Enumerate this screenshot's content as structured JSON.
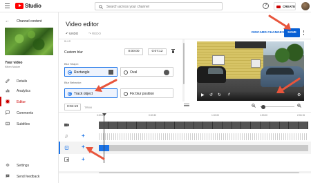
{
  "header": {
    "logo_text": "Studio",
    "search_placeholder": "Search across your channel",
    "help_symbol": "?",
    "create_label": "CREATE"
  },
  "sidebar": {
    "back_label": "Channel content",
    "video_title": "Your video",
    "video_subtitle": "Kitten Nature",
    "items": [
      {
        "label": "Details",
        "icon": "pencil-icon",
        "active": false
      },
      {
        "label": "Analytics",
        "icon": "bar-chart-icon",
        "active": false
      },
      {
        "label": "Editor",
        "icon": "film-icon",
        "active": true
      },
      {
        "label": "Comments",
        "icon": "comment-icon",
        "active": false
      },
      {
        "label": "Subtitles",
        "icon": "subtitles-icon",
        "active": false
      }
    ],
    "bottom_items": [
      {
        "label": "Settings",
        "icon": "gear-icon"
      },
      {
        "label": "Send feedback",
        "icon": "feedback-icon"
      }
    ]
  },
  "editor": {
    "title": "Video editor",
    "undo_label": "UNDO",
    "redo_label": "REDO",
    "discard_label": "DISCARD CHANGES",
    "save_label": "SAVE",
    "panel_collapse_hint": "BLUR",
    "custom_blur_label": "Custom blur",
    "start_time": "0:00:00",
    "end_time": "0:07:12",
    "blur_shape_label": "Blur Shape:",
    "shape_rect_label": "Rectangle",
    "shape_oval_label": "Oval",
    "blur_behavior_label": "Blur Behavior:",
    "behavior_track_label": "Track object",
    "behavior_fix_label": "Fix blur position",
    "current_time": "0:04:19",
    "trim_label": "TRIM"
  },
  "timeline": {
    "ruler": [
      "0:00:00",
      "0:00:30",
      "1:00:00",
      "1:30:00",
      "2:00:15"
    ]
  },
  "colors": {
    "accent": "#065fd4",
    "brand": "#ff0000",
    "active_nav": "#cc0000",
    "annotation_arrow": "#e8553c"
  }
}
